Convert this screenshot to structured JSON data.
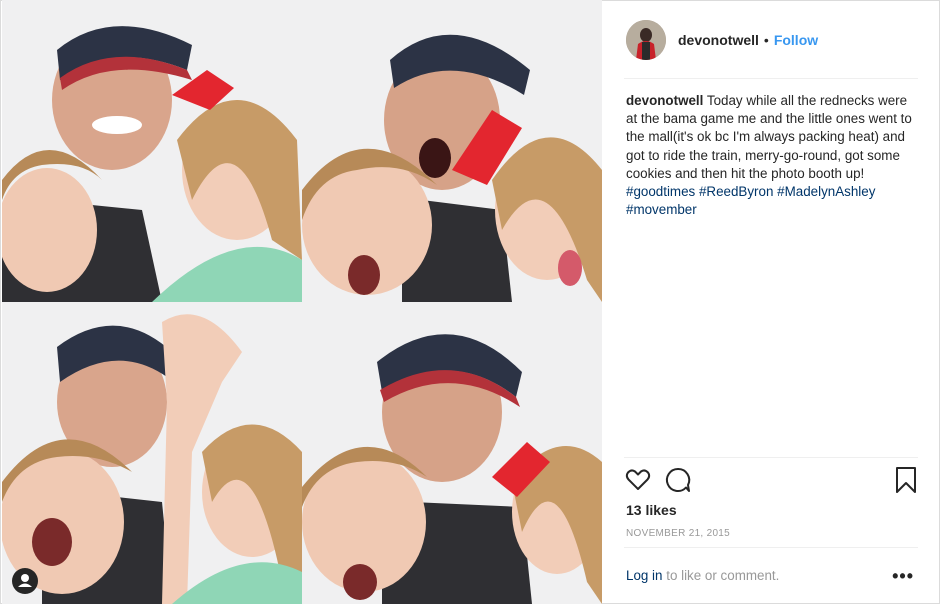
{
  "post": {
    "image_alt": "Photo booth strip: man in baseball cap with two young children making faces",
    "tag_icon": "user-tag-icon"
  },
  "header": {
    "username": "devonotwell",
    "separator": "•",
    "follow_label": "Follow"
  },
  "caption": {
    "username": "devonotwell",
    "text": "Today while all the rednecks were at the bama game me and the little ones went to the mall(it's ok bc I'm always packing heat) and got to ride the train, merry-go-round, got some cookies and then hit the photo booth up!",
    "hashtags": [
      "#goodtimes",
      "#ReedByron",
      "#MadelynAshley",
      "#movember"
    ]
  },
  "actions": {
    "like_icon": "heart-icon",
    "comment_icon": "comment-icon",
    "save_icon": "bookmark-icon"
  },
  "likes": "13 likes",
  "date": "NOVEMBER 21, 2015",
  "footer": {
    "login_link": "Log in",
    "login_text": "to like or comment.",
    "more": "•••"
  },
  "colors": {
    "link_blue": "#3897f0",
    "hashtag": "#003569",
    "muted": "#999999",
    "border": "#dbdbdb"
  }
}
